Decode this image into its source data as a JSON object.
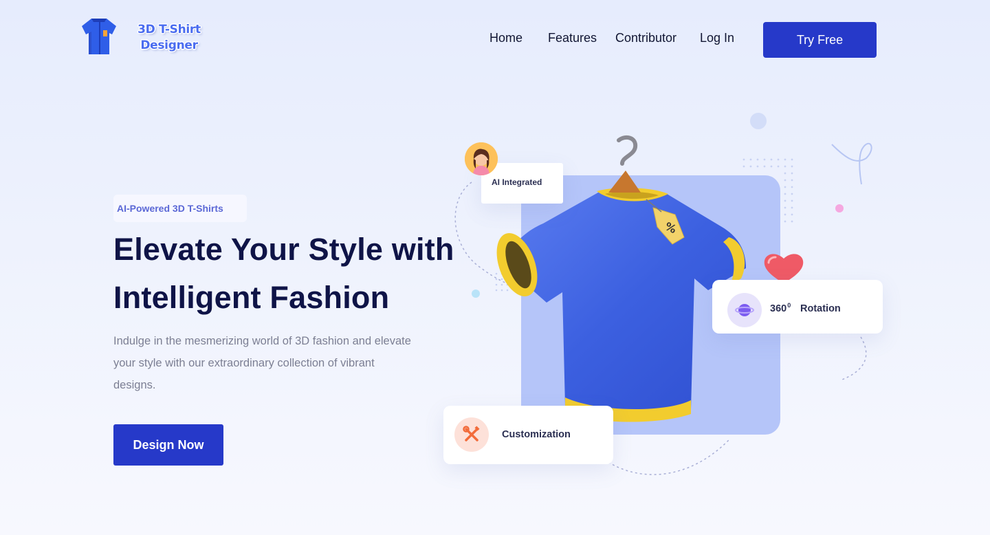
{
  "header": {
    "logo_line1": "3D T-Shirt",
    "logo_line2": "Designer",
    "nav": {
      "home": "Home",
      "features": "Features",
      "contributor": "Contributor",
      "login": "Log In"
    },
    "cta": "Try Free"
  },
  "hero": {
    "badge": "AI-Powered 3D T-Shirts",
    "headline_line1": "Elevate Your Style with",
    "headline_line2": "Intelligent Fashion",
    "description": "Indulge in the mesmerizing world of 3D fashion and elevate your style with our extraordinary collection of vibrant designs.",
    "button": "Design Now"
  },
  "illustration": {
    "ai_card": "AI Integrated",
    "rotation_value": "360",
    "rotation_degree": "0",
    "rotation_label": "Rotation",
    "customization_label": "Customization",
    "tag_symbol": "%"
  },
  "colors": {
    "primary": "#2639c9",
    "panel": "#b5c5f9",
    "shirt": "#3d63e0",
    "trim": "#f2cc2e",
    "heading": "#0f1447"
  },
  "icons": [
    "tshirt-logo-icon",
    "avatar-icon",
    "rotation-icon",
    "tools-icon",
    "heart-icon",
    "hanger-icon"
  ]
}
